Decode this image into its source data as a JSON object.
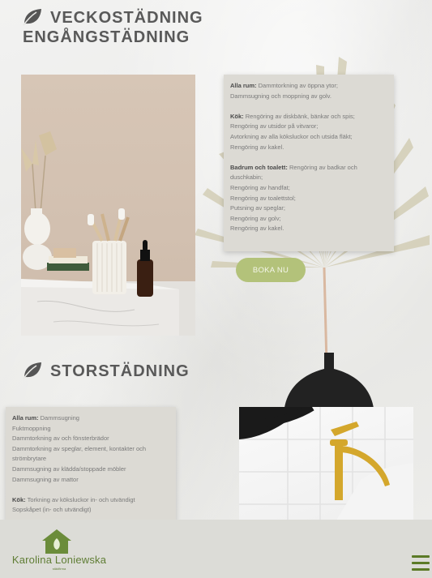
{
  "sections": [
    {
      "heading_line1": "VECKOSTÄDNING",
      "heading_line2": "ENGÅNGSTÄDNING",
      "icon": "leaf-icon"
    },
    {
      "heading": "STORSTÄDNING",
      "icon": "leaf-icon"
    }
  ],
  "card1": {
    "alla_rum_label": "Alla rum:",
    "alla_rum_text": "Dammtorkning av öppna ytor;",
    "alla_rum_line2": "Dammsugning och moppning av golv.",
    "kok_label": "Kök:",
    "kok_text": "Rengöring av diskbänk, bänkar och spis;",
    "kok_line2": "Rengöring av utsidor på vitvaror;",
    "kok_line3": "Avtorkning av alla köksluckor och utsida fläkt;",
    "kok_line4": "Rengöring av kakel.",
    "bad_label": "Badrum och toalett:",
    "bad_text": "Rengöring av badkar och duschkabin;",
    "bad_line2": "Rengöring av handfat;",
    "bad_line3": "Rengöring av toalettstol;",
    "bad_line4": "Putsning av speglar;",
    "bad_line5": "Rengöring av golv;",
    "bad_line6": "Rengöring av kakel."
  },
  "book_button": "BOKA NU",
  "card2": {
    "alla_rum_label": "Alla rum:",
    "alla_rum_text": "Dammsugning",
    "lines": [
      "Fuktmoppning",
      "Dammtorkning av och fönsterbrädor",
      "Dammtorkning av speglar, element, kontakter och strömbrytare",
      "Dammsugning av klädda/stoppade möbler",
      "Dammsugning av mattor"
    ],
    "kok_label": "Kök:",
    "kok_text": "Torkning av köksluckor in- och utvändigt",
    "kok_line2": "Sopskåpet (in- och utvändigt)"
  },
  "footer": {
    "brand": "Karolina Loniewska",
    "sub": "städfirma",
    "menu_icon": "hamburger-menu-icon"
  },
  "colors": {
    "accent_green": "#b3c27a",
    "brand_green": "#5f7d34",
    "heading": "#595959",
    "card_bg": "#dcdad4"
  }
}
